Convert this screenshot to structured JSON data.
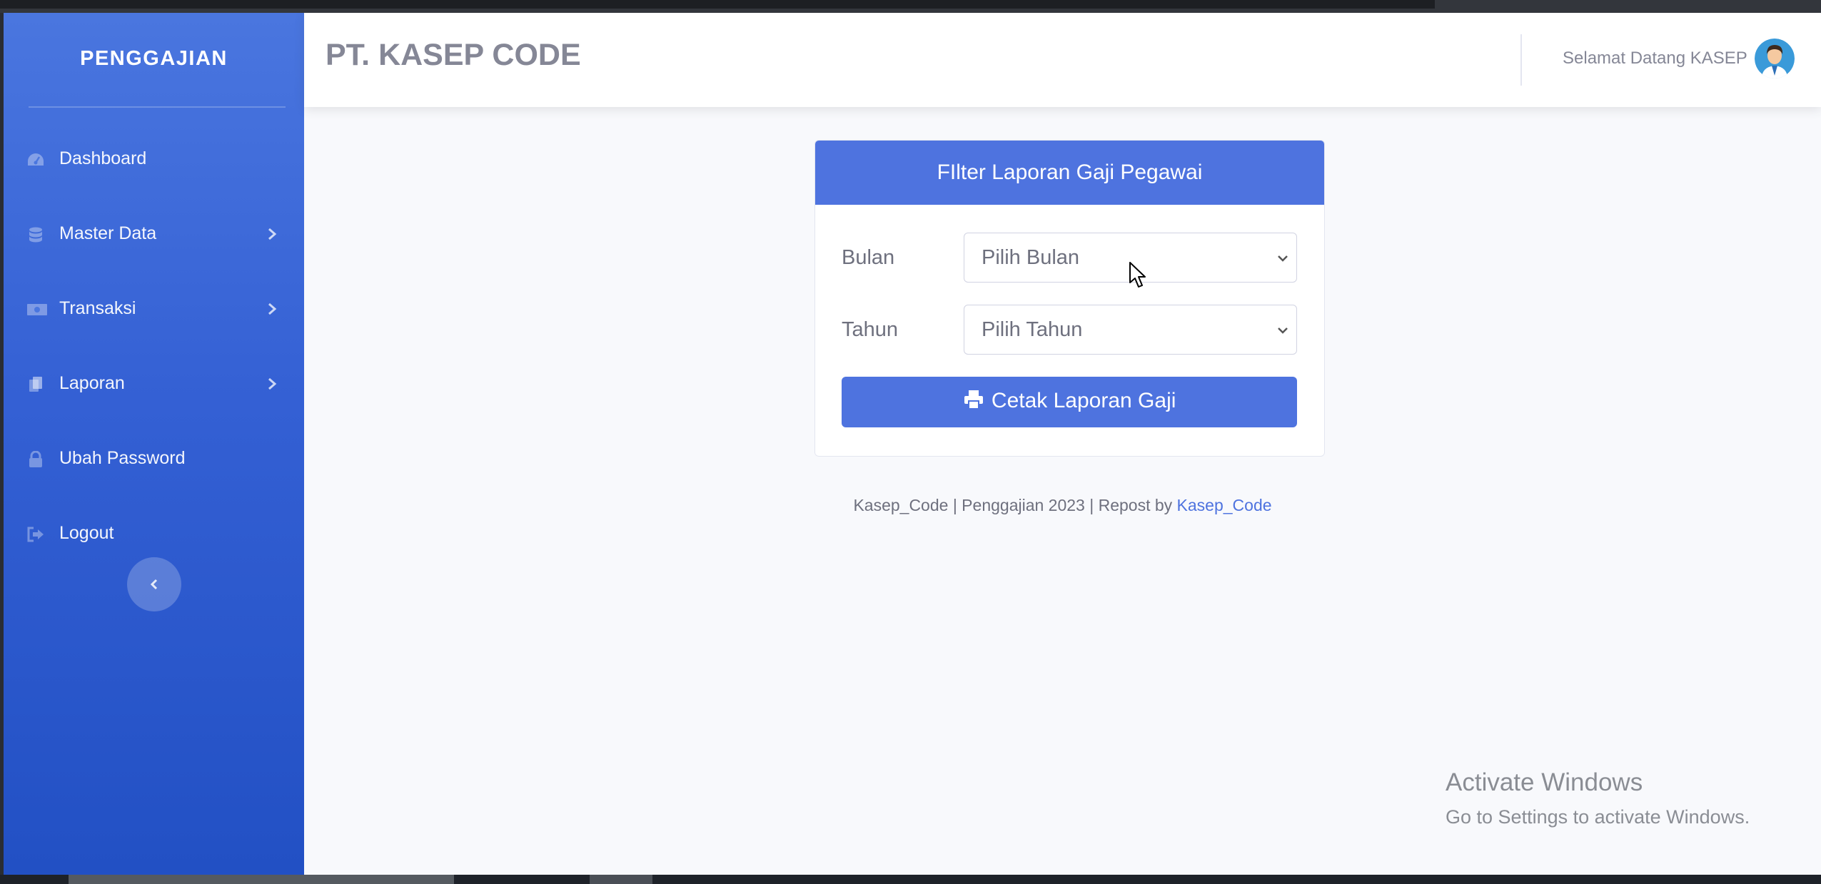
{
  "sidebar": {
    "brand": "PENGGAJIAN",
    "items": [
      {
        "label": "Dashboard",
        "icon": "gauge-icon",
        "has_submenu": false
      },
      {
        "label": "Master Data",
        "icon": "database-icon",
        "has_submenu": true
      },
      {
        "label": "Transaksi",
        "icon": "money-bill-icon",
        "has_submenu": true
      },
      {
        "label": "Laporan",
        "icon": "copy-icon",
        "has_submenu": true
      },
      {
        "label": "Ubah Password",
        "icon": "lock-icon",
        "has_submenu": false
      },
      {
        "label": "Logout",
        "icon": "sign-out-icon",
        "has_submenu": false
      }
    ],
    "toggle_icon": "chevron-left-icon"
  },
  "topbar": {
    "company": "PT. KASEP CODE",
    "welcome": "Selamat Datang KASEP",
    "avatar_icon": "user-avatar"
  },
  "filter_card": {
    "title": "FIlter Laporan Gaji Pegawai",
    "month_label": "Bulan",
    "month_value": "Pilih Bulan",
    "year_label": "Tahun",
    "year_value": "Pilih Tahun",
    "print_button": "Cetak Laporan Gaji",
    "print_icon": "print-icon"
  },
  "footer": {
    "text": "Kasep_Code | Penggajian 2023 | Repost by ",
    "link": "Kasep_Code"
  },
  "watermark": {
    "title": "Activate Windows",
    "subtitle": "Go to Settings to activate Windows."
  },
  "colors": {
    "primary": "#4e73df",
    "sidebar_top": "#4a76df",
    "sidebar_bottom": "#2250c4",
    "content_bg": "#f8f9fc",
    "text_muted": "#858796"
  }
}
